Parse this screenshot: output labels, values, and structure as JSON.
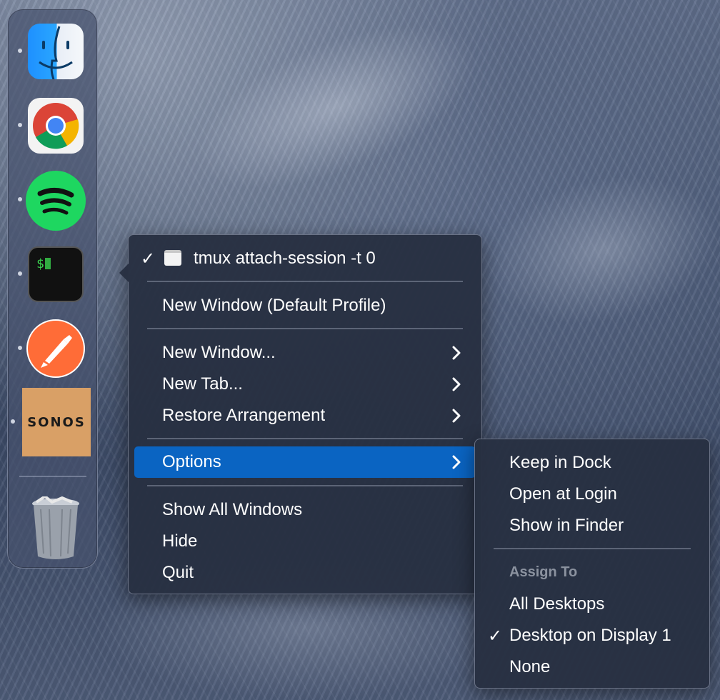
{
  "dock": {
    "apps": [
      {
        "name": "Finder",
        "running": true
      },
      {
        "name": "Google Chrome",
        "running": true
      },
      {
        "name": "Spotify",
        "running": true
      },
      {
        "name": "Terminal",
        "running": true
      },
      {
        "name": "Postman",
        "running": true
      },
      {
        "name": "SONOS",
        "running": true
      }
    ],
    "sonos_label": "SONOS",
    "trash": "Trash"
  },
  "context_menu": {
    "window_item": {
      "checked": true,
      "label": "tmux attach-session -t 0"
    },
    "new_window_default": "New Window (Default Profile)",
    "new_window": "New Window...",
    "new_tab": "New Tab...",
    "restore_arrangement": "Restore Arrangement",
    "options": "Options",
    "show_all_windows": "Show All Windows",
    "hide": "Hide",
    "quit": "Quit"
  },
  "options_submenu": {
    "keep_in_dock": "Keep in Dock",
    "open_at_login": "Open at Login",
    "show_in_finder": "Show in Finder",
    "assign_to_header": "Assign To",
    "all_desktops": "All Desktops",
    "desktop_on_display": "Desktop on Display 1",
    "desktop_on_display_checked": true,
    "none": "None"
  },
  "check_glyph": "✓",
  "colors": {
    "highlight": "#0a64c2",
    "menu_bg": "#283042"
  }
}
